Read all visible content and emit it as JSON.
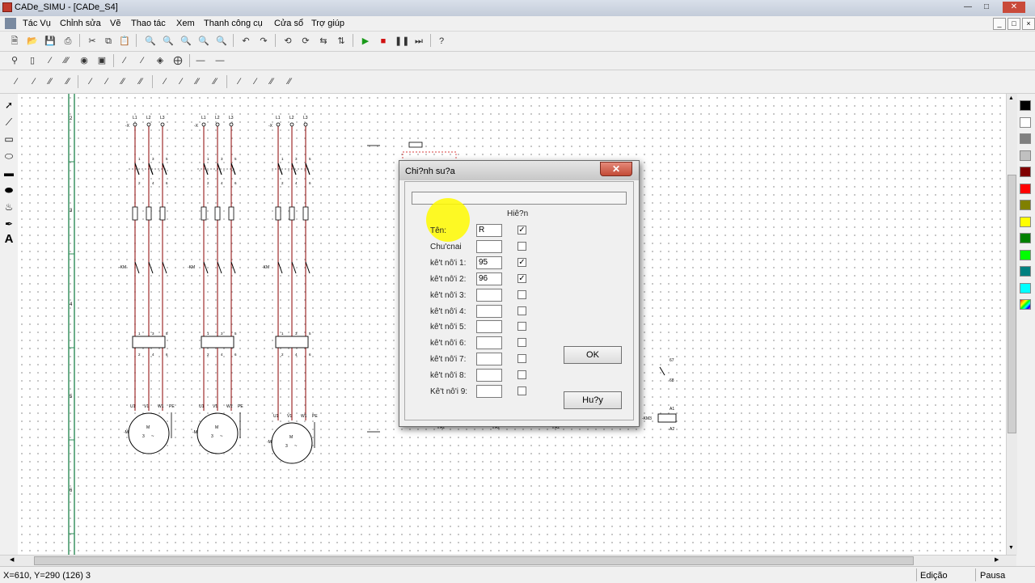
{
  "window": {
    "title": "CADe_SIMU - [CADe_S4]",
    "controls": [
      "minimize-icon",
      "maximize-icon",
      "close-icon"
    ]
  },
  "menu": [
    "Tác Vụ",
    "Chỉnh sửa",
    "Vẽ",
    "Thao tác",
    "Xem",
    "Thanh công cụ",
    "Cửa sổ",
    "Trợ giúp"
  ],
  "ruler_numbers": [
    "2",
    "3",
    "4",
    "5",
    "6"
  ],
  "circuits": [
    {
      "lines": [
        "L1",
        "L2",
        "L3"
      ],
      "breaker": "-X",
      "contactor": "-KM",
      "motor": "-M",
      "motor_text": [
        "M",
        "3",
        "~"
      ],
      "terminals": [
        "U1",
        "V1",
        "W1",
        "PE"
      ],
      "pins": [
        "1",
        "2",
        "3",
        "4",
        "5",
        "6"
      ]
    },
    {
      "lines": [
        "L1",
        "L2",
        "L3"
      ],
      "breaker": "-X",
      "contactor": "-KM",
      "motor": "-M",
      "motor_text": [
        "M",
        "3",
        "~"
      ],
      "terminals": [
        "U1",
        "V1",
        "W1",
        "PE"
      ],
      "pins": [
        "1",
        "2",
        "3",
        "4",
        "5",
        "6"
      ]
    },
    {
      "lines": [
        "L1",
        "L2",
        "L3"
      ],
      "breaker": "-X",
      "contactor": "-KM",
      "motor": "-M",
      "motor_text": [
        "M",
        "3",
        "~"
      ],
      "terminals": [
        "U1",
        "V1",
        "W1",
        "PE"
      ],
      "pins": [
        "1",
        "2",
        "3",
        "4",
        "5",
        "6"
      ]
    }
  ],
  "side_labels": {
    "contact_a": "67",
    "contact_b": "68",
    "coil_a1": "A1",
    "coil_a2": "A2",
    "coil_tag": "-KM3",
    "strip_a2": [
      "A2",
      "A2",
      "A2"
    ]
  },
  "dialog": {
    "title": "Chi?nh su?a",
    "show_header": "Hiê?n",
    "rows": [
      {
        "label": "Tên:",
        "value": "R",
        "checked": true
      },
      {
        "label": "Chu'cnai",
        "value": "",
        "checked": false
      },
      {
        "label": "kê't nô'i 1:",
        "value": "95",
        "checked": true
      },
      {
        "label": "kê't nô'i 2:",
        "value": "96",
        "checked": true
      },
      {
        "label": "kê't nô'i 3:",
        "value": "",
        "checked": false
      },
      {
        "label": "kê't nô'i 4:",
        "value": "",
        "checked": false
      },
      {
        "label": "kê't nô'i 5:",
        "value": "",
        "checked": false
      },
      {
        "label": "kê't nô'i 6:",
        "value": "",
        "checked": false
      },
      {
        "label": "kê't nô'i 7:",
        "value": "",
        "checked": false
      },
      {
        "label": "kê't nô'i 8:",
        "value": "",
        "checked": false
      },
      {
        "label": "Kê't nô'i 9:",
        "value": "",
        "checked": false
      }
    ],
    "ok_label": "OK",
    "cancel_label": "Hu?y"
  },
  "status": {
    "coords": "X=610, Y=290 (126) 3",
    "mode": "Edição",
    "state": "Pausa"
  },
  "colors": [
    "#000000",
    "#ffffff",
    "#808080",
    "#c0c0c0",
    "#800000",
    "#ff0000",
    "#808000",
    "#ffff00",
    "#008000",
    "#00ff00",
    "#008080",
    "#00ffff"
  ],
  "accent_colors": {
    "wire": "#8b0000",
    "rail": "#2e8b57",
    "highlight": "#ffff00"
  }
}
